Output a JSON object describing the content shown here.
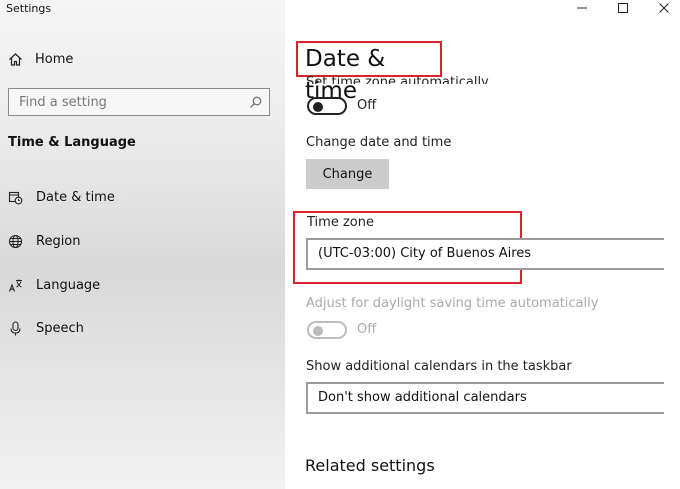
{
  "window": {
    "title": "Settings"
  },
  "sidebar": {
    "home_label": "Home",
    "search_placeholder": "Find a setting",
    "section_title": "Time & Language",
    "items": [
      {
        "label": "Date & time",
        "icon": "calendar-clock-icon"
      },
      {
        "label": "Region",
        "icon": "globe-icon"
      },
      {
        "label": "Language",
        "icon": "language-icon"
      },
      {
        "label": "Speech",
        "icon": "microphone-icon"
      }
    ]
  },
  "main": {
    "title": "Date & time",
    "set_timezone_auto": {
      "label": "Set time zone automatically",
      "state": "Off"
    },
    "change_date_time": {
      "label": "Change date and time",
      "button": "Change"
    },
    "time_zone": {
      "label": "Time zone",
      "value": "(UTC-03:00) City of Buenos Aires"
    },
    "daylight_saving": {
      "label": "Adjust for daylight saving time automatically",
      "state": "Off"
    },
    "additional_calendars": {
      "label": "Show additional calendars in the taskbar",
      "value": "Don't show additional calendars"
    },
    "related_settings": "Related settings"
  },
  "colors": {
    "highlight": "#d9232d",
    "button_bg": "#cccccc",
    "sidebar": "#e6e6e6"
  }
}
